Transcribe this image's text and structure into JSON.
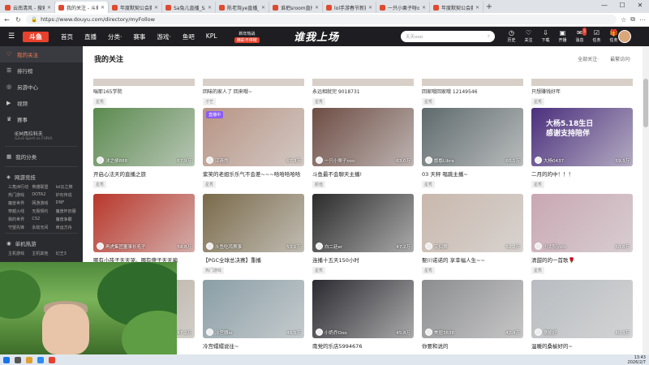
{
  "browser": {
    "tabs": [
      {
        "label": "云南清风 - 搜索",
        "active": false
      },
      {
        "label": "我的关注 - 斗鱼",
        "active": true
      },
      {
        "label": "年度默契公会赛_斗...",
        "active": false
      },
      {
        "label": "Sa兔儿直播_Sa兔...",
        "active": false
      },
      {
        "label": "陈老驾ye直播_陈老...",
        "active": false
      },
      {
        "label": "谁把sroom直播_谁...",
        "active": false
      },
      {
        "label": "lol手游春节新赛事_您...",
        "active": false
      },
      {
        "label": "一只小栗子呀ovo...",
        "active": false
      },
      {
        "label": "年度默契公会赛_斗...",
        "active": false
      }
    ],
    "url": "https://www.douyu.com/directory/myFollow"
  },
  "site": {
    "logo": "斗鱼",
    "nav": [
      "首页",
      "直播",
      "分类·",
      "赛事",
      "游戏·",
      "鱼吧",
      "KPL"
    ],
    "hot_label": "新年热战",
    "hot_sub": "精彩不停歇",
    "banner": "谁我上场",
    "search_placeholder": "天天ooo",
    "header_icons": [
      {
        "label": "历史",
        "icon": "history-icon"
      },
      {
        "label": "关注",
        "icon": "heart-icon"
      },
      {
        "label": "下载",
        "icon": "download-icon"
      },
      {
        "label": "开播",
        "icon": "camera-icon"
      },
      {
        "label": "消息",
        "icon": "mail-icon",
        "badge": "5"
      },
      {
        "label": "任务",
        "icon": "task-icon"
      },
      {
        "label": "任务",
        "icon": "gift-icon"
      }
    ]
  },
  "sidebar": {
    "items": [
      {
        "label": "我的关注",
        "icon": "heart-icon",
        "active": true
      },
      {
        "label": "排行榜",
        "icon": "rank-icon",
        "active": false
      },
      {
        "label": "另游中心",
        "icon": "game-icon",
        "active": false
      },
      {
        "label": "视频",
        "icon": "video-icon",
        "active": false
      },
      {
        "label": "赛事",
        "icon": "trophy-icon",
        "active": false
      }
    ],
    "recent": {
      "title": "IEM西拉科夫",
      "sub": "G2vS Spirit vs FURIA"
    },
    "section1": {
      "label": "我的分类",
      "icon": "grid-icon"
    },
    "section2": {
      "label": "网游竞技",
      "icon": "controller-icon"
    },
    "games1": [
      "三角洲行动",
      "英雄联盟",
      "lol云之牌",
      "热门游戏",
      "DOTA2",
      "炉石传说",
      "魔兽世界",
      "网游游戏",
      "DNF",
      "穿越火线",
      "无畏契约",
      "魔兽怀旧服",
      "我的世界",
      "CS2",
      "魔兽争霸",
      "守望先锋",
      "永劫无间",
      "命运方舟"
    ],
    "section3": {
      "label": "单机热游",
      "icon": "disc-icon"
    },
    "games2": [
      "主机游戏",
      "主机其他",
      "幻王3"
    ]
  },
  "main": {
    "title": "我的关注",
    "filter1": "全部关注·",
    "filter2": "最繁访问·",
    "row0": [
      {
        "title": "喘耶165学院",
        "tag": "星秀"
      },
      {
        "title": "回味的家人了 回来哦~",
        "tag": "才艺"
      },
      {
        "title": "永远相就完 9018731",
        "tag": "星秀"
      },
      {
        "title": "回家哦回家哦 12149546",
        "tag": "星秀"
      },
      {
        "title": "只想赚钱好年",
        "tag": "星秀"
      }
    ],
    "cards": [
      {
        "name": "沐之柳888",
        "views": "67.9万",
        "title": "开启心法天的直播之旅",
        "tag": "星秀",
        "bg": "#5b8a4f",
        "badge": ""
      },
      {
        "name": "江清然",
        "views": "67.3万",
        "title": "紫笑的老姐乐乐气不会差~~~哈哈哈哈哈",
        "tag": "星秀",
        "bg": "#b89484",
        "badge": "直播中"
      },
      {
        "name": "一只小栗子ovo",
        "views": "63.0万",
        "title": "斗鱼最不会聊天主播!",
        "tag": "颜值",
        "bg": "#6e4d44",
        "badge": ""
      },
      {
        "name": "憨憨Libra",
        "views": "60.1万",
        "title": "03 天秤 唱跳主播~",
        "tag": "星秀",
        "bg": "#5f6a6d",
        "badge": ""
      },
      {
        "name": "大杨0437",
        "views": "59.3万",
        "title": "二月的的中！！！",
        "tag": "星秀",
        "bg": "#4b2f7d",
        "badge": "",
        "promo": [
          "大杨5.18生日",
          "感谢支持陪伴"
        ]
      },
      {
        "name": "再虎集团董事长毛子",
        "views": "54.8万",
        "title": "哪有小孩子天天哭。哪有傻子天天骗",
        "tag": "星秀",
        "bg": "#b9372b",
        "badge": ""
      },
      {
        "name": "斗鱼吃鸡赛事",
        "views": "53.1万",
        "title": "【PGC全球总决赛】重播",
        "tag": "热门游戏",
        "bg": "#7a6a4a",
        "badge": ""
      },
      {
        "name": "白二廷er",
        "views": "47.2万",
        "title": "连播十五天150小时",
        "tag": "星秀",
        "bg": "#2b2b2b",
        "badge": ""
      },
      {
        "name": "艾仙舞",
        "views": "52.2万",
        "title": "娶川诺诺的 享幸福人生~~",
        "tag": "星秀",
        "bg": "#c9b8ad",
        "badge": ""
      },
      {
        "name": "小太阳yolo",
        "views": "50.8万",
        "title": "清甜的的一首歌🌹",
        "tag": "星秀",
        "bg": "#c9a7b3",
        "badge": ""
      },
      {
        "name": "",
        "views": "47.2万",
        "title": "",
        "tag": "",
        "bg": "#b3a898",
        "badge": ""
      },
      {
        "name": "冷宫嬛er",
        "views": "46.5万",
        "title": "冷宫嬛嬛说往~",
        "tag": "",
        "bg": "#8a9ea6",
        "badge": ""
      },
      {
        "name": "小奶乔Ooo",
        "views": "45.8万",
        "title": "南党的乐店5994676",
        "tag": "",
        "bg": "#2a2a30",
        "badge": ""
      },
      {
        "name": "美妞3636",
        "views": "42.4万",
        "title": "你要和说的",
        "tag": "",
        "bg": "#8c8d8f",
        "badge": ""
      },
      {
        "name": "桑榆好",
        "views": "40.3万",
        "title": "温暖的桑榆好的~",
        "tag": "",
        "bg": "#b8bcc0",
        "badge": ""
      }
    ]
  },
  "taskbar": {
    "time": "13:43",
    "date": "2026/2/7"
  }
}
